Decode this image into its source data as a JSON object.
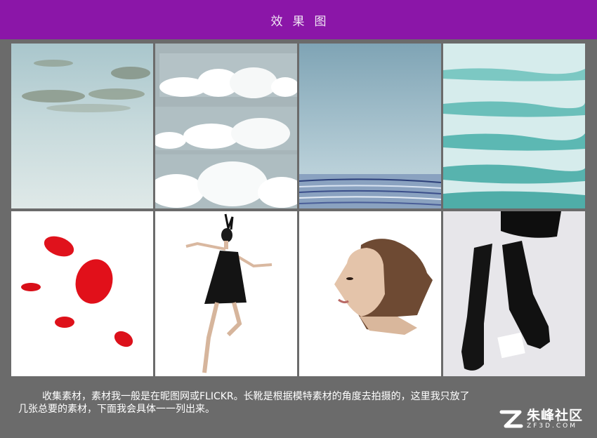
{
  "header": {
    "title": "效果图"
  },
  "gallery": {
    "items": [
      {
        "name": "sky-cloudy-image"
      },
      {
        "name": "cloud-strips-image"
      },
      {
        "name": "sky-water-ripple-image"
      },
      {
        "name": "teal-waves-image"
      },
      {
        "name": "red-petals-image"
      },
      {
        "name": "dancer-black-dress-image"
      },
      {
        "name": "woman-portrait-image"
      },
      {
        "name": "black-boots-image"
      }
    ]
  },
  "caption": {
    "line1": "收集素材，素材我一般是在昵图网或FLICKR。长靴是根据模特素材的角度去拍摄的，这里我只放了",
    "line2": "几张总要的素材，下面我会具体一一列出来。"
  },
  "logo": {
    "cn": "朱峰社区",
    "en": "ZF3D.COM"
  },
  "colors": {
    "header_bg": "#8b16a8",
    "page_bg": "#6b6b6b"
  }
}
